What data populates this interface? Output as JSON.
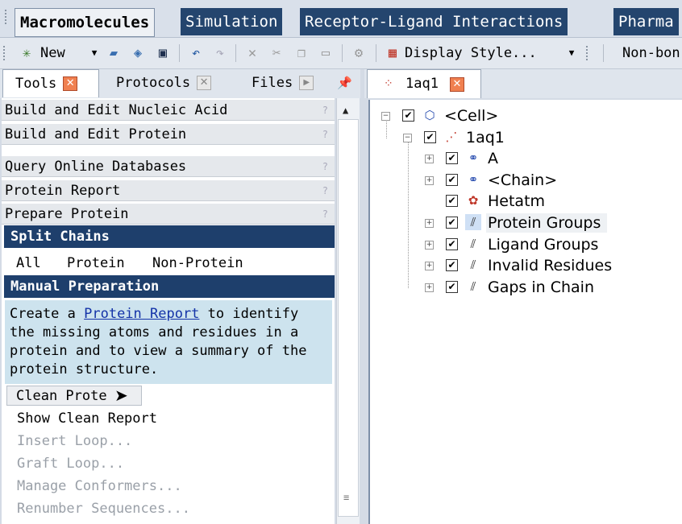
{
  "ribbon": {
    "tabs": [
      {
        "label": "Macromolecules"
      },
      {
        "label": "Simulation"
      },
      {
        "label": "Receptor-Ligand Interactions"
      },
      {
        "label": "Pharma"
      }
    ]
  },
  "toolbar": {
    "new_label": "New",
    "display_style_label": "Display Style...",
    "nonbond_label": "Non-bon"
  },
  "left_tabs": [
    {
      "label": "Tools"
    },
    {
      "label": "Protocols"
    },
    {
      "label": "Files"
    }
  ],
  "tools": {
    "groups": [
      {
        "label": "Build and Edit Nucleic Acid",
        "help": "?"
      },
      {
        "label": "Build and Edit Protein",
        "help": "?"
      },
      {
        "label": "Query Online Databases",
        "help": "?"
      },
      {
        "label": "Protein Report",
        "help": "?"
      },
      {
        "label": "Prepare Protein",
        "help": "?"
      }
    ],
    "split_chains": {
      "title": "Split Chains",
      "options": [
        "All",
        "Protein",
        "Non-Protein"
      ]
    },
    "manual_prep": {
      "title": "Manual Preparation",
      "desc_pre": "Create a ",
      "desc_link": "Protein Report",
      "desc_post": " to identify\nthe missing atoms and residues in a\nprotein and to view a summary of the\nprotein structure.",
      "clean_button": "Clean Prote",
      "actions": [
        {
          "label": "Show Clean Report",
          "enabled": true
        },
        {
          "label": "Insert Loop...",
          "enabled": false
        },
        {
          "label": "Graft Loop...",
          "enabled": false
        },
        {
          "label": "Manage Conformers...",
          "enabled": false
        },
        {
          "label": "Renumber Sequences...",
          "enabled": false
        }
      ]
    }
  },
  "document_tab": {
    "label": "1aq1"
  },
  "tree": {
    "rows": [
      {
        "label": "<Cell>",
        "icon": "cell-icon",
        "checked": true,
        "expander": "minus"
      },
      {
        "label": "1aq1",
        "icon": "molecule-icon",
        "checked": true,
        "expander": "minus"
      },
      {
        "label": "A",
        "icon": "chain-icon",
        "checked": true,
        "expander": "plus"
      },
      {
        "label": "<Chain>",
        "icon": "chain-icon",
        "checked": true,
        "expander": "plus"
      },
      {
        "label": "Hetatm",
        "icon": "hetatm-icon",
        "checked": true,
        "expander": "none"
      },
      {
        "label": "Protein Groups",
        "icon": "group-icon",
        "checked": true,
        "expander": "plus",
        "highlight": true
      },
      {
        "label": "Ligand Groups",
        "icon": "group-icon",
        "checked": true,
        "expander": "plus"
      },
      {
        "label": "Invalid Residues",
        "icon": "group-icon",
        "checked": true,
        "expander": "plus"
      },
      {
        "label": "Gaps in Chain",
        "icon": "group-icon",
        "checked": true,
        "expander": "plus"
      }
    ]
  },
  "colors": {
    "ribbon_tab_bg": "#24456e",
    "section_header_bg": "#1e3f6c",
    "desc_bg": "#cde3ee",
    "link": "#1433a8",
    "close_orange": "#f08050"
  }
}
